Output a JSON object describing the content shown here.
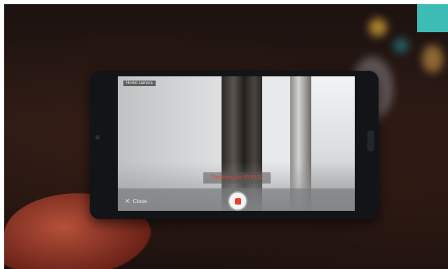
{
  "camera_ui": {
    "mode_tag": "Home camera",
    "recording_banner": "Streaming live 00:00:32",
    "close_label": "Close",
    "close_icon": "close-icon",
    "record_icon": "record-stop-icon"
  },
  "colors": {
    "accent_teal": "#3cbcb4",
    "record_red": "#e8402e"
  }
}
